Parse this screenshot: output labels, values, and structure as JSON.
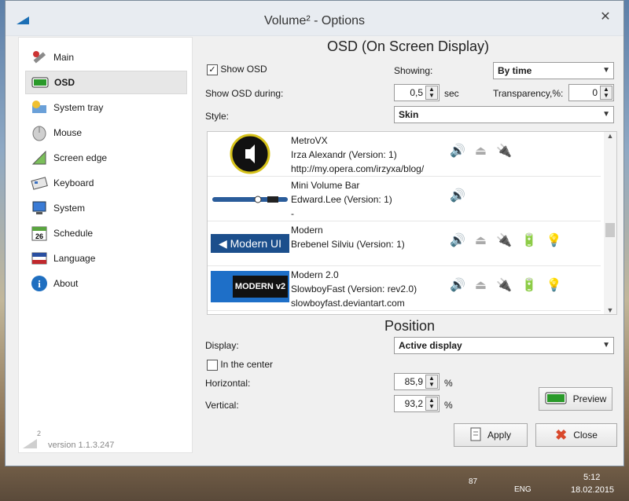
{
  "window": {
    "title": "Volume² - Options",
    "close": "✕"
  },
  "sidebar": {
    "items": [
      {
        "label": "Main",
        "icon": "tools-icon"
      },
      {
        "label": "OSD",
        "icon": "osd-icon"
      },
      {
        "label": "System tray",
        "icon": "system-tray-icon"
      },
      {
        "label": "Mouse",
        "icon": "mouse-icon"
      },
      {
        "label": "Screen edge",
        "icon": "screen-edge-icon"
      },
      {
        "label": "Keyboard",
        "icon": "keyboard-icon"
      },
      {
        "label": "System",
        "icon": "system-icon"
      },
      {
        "label": "Schedule",
        "icon": "calendar-icon"
      },
      {
        "label": "Language",
        "icon": "flag-icon"
      },
      {
        "label": "About",
        "icon": "info-icon"
      }
    ],
    "version": "version 1.1.3.247",
    "version_mark": "2"
  },
  "osd": {
    "title": "OSD (On Screen Display)",
    "show_osd_label": "Show OSD",
    "show_osd_checked": "✓",
    "showing_label": "Showing:",
    "showing_value": "By time",
    "during_label": "Show OSD during:",
    "during_value": "0,5",
    "during_unit": "sec",
    "transparency_label": "Transparency,%:",
    "transparency_value": "0",
    "style_label": "Style:",
    "style_value": "Skin"
  },
  "skins": [
    {
      "name": "MetroVX",
      "author": "Irza Alexandr (Version: 1)",
      "url": "http://my.opera.com/irzyxa/blog/"
    },
    {
      "name": "Mini Volume Bar",
      "author": "Edward.Lee (Version: 1)",
      "url": "-"
    },
    {
      "name": "Modern",
      "author": "Brebenel Silviu (Version: 1)",
      "url": "",
      "thumb": "Modern UI"
    },
    {
      "name": "Modern 2.0",
      "author": "SlowboyFast (Version: rev2.0)",
      "url": "slowboyfast.deviantart.com",
      "thumb": "MODERN v2"
    }
  ],
  "position": {
    "title": "Position",
    "display_label": "Display:",
    "display_value": "Active display",
    "center_label": "In the center",
    "horizontal_label": "Horizontal:",
    "horizontal_value": "85,9",
    "vertical_label": "Vertical:",
    "vertical_value": "93,2",
    "percent": "%",
    "preview_label": "Preview"
  },
  "buttons": {
    "apply": "Apply",
    "close": "Close"
  },
  "taskbar": {
    "lang": "ENG",
    "time": "5:12",
    "date": "18.02.2015",
    "tray_num": "87"
  },
  "colors": {
    "accent": "#1c6fb5",
    "osd_green": "#2a9a2a",
    "close_red": "#d9482b"
  }
}
